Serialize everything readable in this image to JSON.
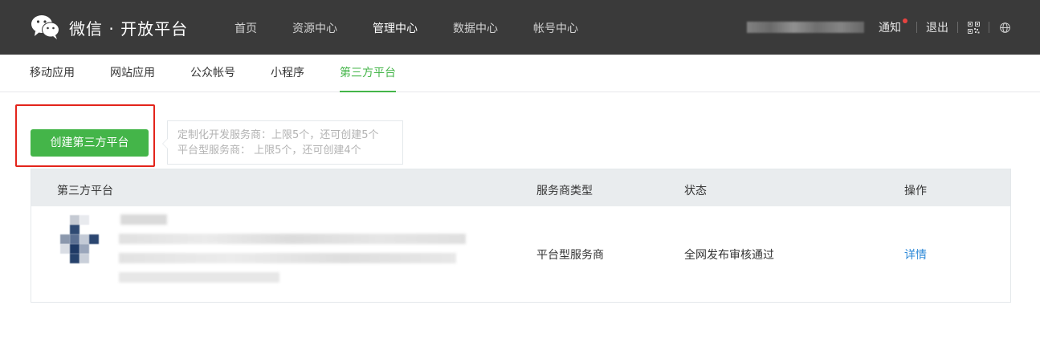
{
  "header": {
    "brand": "微信 · 开放平台",
    "nav": [
      "首页",
      "资源中心",
      "管理中心",
      "数据中心",
      "帐号中心"
    ],
    "active_nav": "管理中心",
    "notify_label": "通知",
    "logout_label": "退出",
    "icons": [
      "wechat-logo-icon",
      "qrcode-icon",
      "globe-icon"
    ]
  },
  "subnav": {
    "tabs": [
      "移动应用",
      "网站应用",
      "公众帐号",
      "小程序",
      "第三方平台"
    ],
    "active_tab": "第三方平台"
  },
  "create": {
    "button_label": "创建第三方平台",
    "quota_lines": [
      "定制化开发服务商：上限5个，还可创建5个",
      "平台型服务商： 上限5个，还可创建4个"
    ]
  },
  "table": {
    "headers": [
      "第三方平台",
      "服务商类型",
      "状态",
      "操作"
    ],
    "rows": [
      {
        "type": "平台型服务商",
        "status": "全网发布审核通过",
        "action": "详情"
      }
    ]
  },
  "colors": {
    "header_bg": "#3a3a3a",
    "accent_green": "#44b549",
    "link_blue": "#2c88d7",
    "highlight_red": "#e3241b"
  }
}
